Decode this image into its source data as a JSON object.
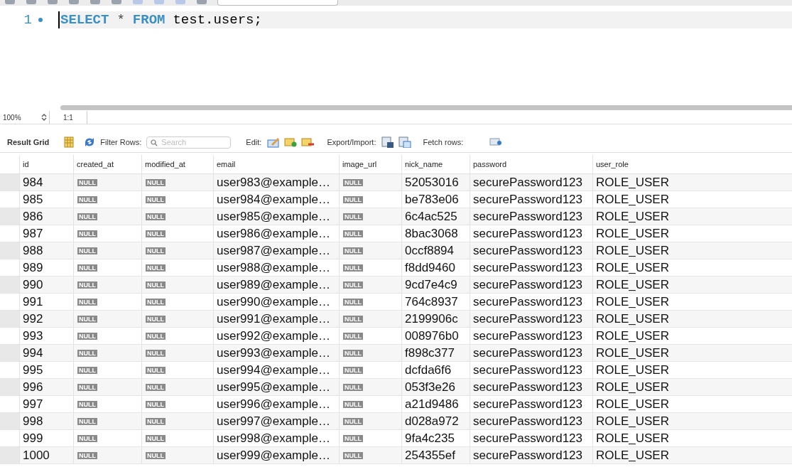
{
  "editor": {
    "lines": [
      {
        "number": "1",
        "segments": [
          {
            "kind": "keyword",
            "text": "SELECT"
          },
          {
            "kind": "operator",
            "text": "*"
          },
          {
            "kind": "keyword",
            "text": "FROM"
          },
          {
            "kind": "plain",
            "text": "test.users;"
          }
        ]
      }
    ]
  },
  "status": {
    "zoom": "100%",
    "position": "1:1"
  },
  "result_toolbar": {
    "title": "Result Grid",
    "filter_label": "Filter Rows:",
    "search_placeholder": "Search",
    "edit_label": "Edit:",
    "export_label": "Export/Import:",
    "fetch_label": "Fetch rows:"
  },
  "table": {
    "columns": [
      "id",
      "created_at",
      "modified_at",
      "email",
      "image_url",
      "nick_name",
      "password",
      "user_role"
    ],
    "rows": [
      [
        "984",
        {
          "kind": "null",
          "text": "NULL"
        },
        {
          "kind": "null",
          "text": "NULL"
        },
        "user983@example…",
        {
          "kind": "null",
          "text": "NULL"
        },
        "52053016",
        "securePassword123",
        "ROLE_USER"
      ],
      [
        "985",
        {
          "kind": "null",
          "text": "NULL"
        },
        {
          "kind": "null",
          "text": "NULL"
        },
        "user984@example…",
        {
          "kind": "null",
          "text": "NULL"
        },
        "be783e06",
        "securePassword123",
        "ROLE_USER"
      ],
      [
        "986",
        {
          "kind": "null",
          "text": "NULL"
        },
        {
          "kind": "null",
          "text": "NULL"
        },
        "user985@example…",
        {
          "kind": "null",
          "text": "NULL"
        },
        "6c4ac525",
        "securePassword123",
        "ROLE_USER"
      ],
      [
        "987",
        {
          "kind": "null",
          "text": "NULL"
        },
        {
          "kind": "null",
          "text": "NULL"
        },
        "user986@example…",
        {
          "kind": "null",
          "text": "NULL"
        },
        "8bac3068",
        "securePassword123",
        "ROLE_USER"
      ],
      [
        "988",
        {
          "kind": "null",
          "text": "NULL"
        },
        {
          "kind": "null",
          "text": "NULL"
        },
        "user987@example…",
        {
          "kind": "null",
          "text": "NULL"
        },
        "0ccf8894",
        "securePassword123",
        "ROLE_USER"
      ],
      [
        "989",
        {
          "kind": "null",
          "text": "NULL"
        },
        {
          "kind": "null",
          "text": "NULL"
        },
        "user988@example…",
        {
          "kind": "null",
          "text": "NULL"
        },
        "f8dd9460",
        "securePassword123",
        "ROLE_USER"
      ],
      [
        "990",
        {
          "kind": "null",
          "text": "NULL"
        },
        {
          "kind": "null",
          "text": "NULL"
        },
        "user989@example…",
        {
          "kind": "null",
          "text": "NULL"
        },
        "9cd7e4c9",
        "securePassword123",
        "ROLE_USER"
      ],
      [
        "991",
        {
          "kind": "null",
          "text": "NULL"
        },
        {
          "kind": "null",
          "text": "NULL"
        },
        "user990@example…",
        {
          "kind": "null",
          "text": "NULL"
        },
        "764c8937",
        "securePassword123",
        "ROLE_USER"
      ],
      [
        "992",
        {
          "kind": "null",
          "text": "NULL"
        },
        {
          "kind": "null",
          "text": "NULL"
        },
        "user991@example…",
        {
          "kind": "null",
          "text": "NULL"
        },
        "2199906c",
        "securePassword123",
        "ROLE_USER"
      ],
      [
        "993",
        {
          "kind": "null",
          "text": "NULL"
        },
        {
          "kind": "null",
          "text": "NULL"
        },
        "user992@example…",
        {
          "kind": "null",
          "text": "NULL"
        },
        "008976b0",
        "securePassword123",
        "ROLE_USER"
      ],
      [
        "994",
        {
          "kind": "null",
          "text": "NULL"
        },
        {
          "kind": "null",
          "text": "NULL"
        },
        "user993@example…",
        {
          "kind": "null",
          "text": "NULL"
        },
        "f898c377",
        "securePassword123",
        "ROLE_USER"
      ],
      [
        "995",
        {
          "kind": "null",
          "text": "NULL"
        },
        {
          "kind": "null",
          "text": "NULL"
        },
        "user994@example…",
        {
          "kind": "null",
          "text": "NULL"
        },
        "dcfda6f6",
        "securePassword123",
        "ROLE_USER"
      ],
      [
        "996",
        {
          "kind": "null",
          "text": "NULL"
        },
        {
          "kind": "null",
          "text": "NULL"
        },
        "user995@example…",
        {
          "kind": "null",
          "text": "NULL"
        },
        "053f3e26",
        "securePassword123",
        "ROLE_USER"
      ],
      [
        "997",
        {
          "kind": "null",
          "text": "NULL"
        },
        {
          "kind": "null",
          "text": "NULL"
        },
        "user996@example…",
        {
          "kind": "null",
          "text": "NULL"
        },
        "a21d9486",
        "securePassword123",
        "ROLE_USER"
      ],
      [
        "998",
        {
          "kind": "null",
          "text": "NULL"
        },
        {
          "kind": "null",
          "text": "NULL"
        },
        "user997@example…",
        {
          "kind": "null",
          "text": "NULL"
        },
        "d028a972",
        "securePassword123",
        "ROLE_USER"
      ],
      [
        "999",
        {
          "kind": "null",
          "text": "NULL"
        },
        {
          "kind": "null",
          "text": "NULL"
        },
        "user998@example…",
        {
          "kind": "null",
          "text": "NULL"
        },
        "9fa4c235",
        "securePassword123",
        "ROLE_USER"
      ],
      [
        "1000",
        {
          "kind": "null",
          "text": "NULL"
        },
        {
          "kind": "null",
          "text": "NULL"
        },
        "user999@example…",
        {
          "kind": "null",
          "text": "NULL"
        },
        "254355ef",
        "securePassword123",
        "ROLE_USER"
      ]
    ]
  }
}
